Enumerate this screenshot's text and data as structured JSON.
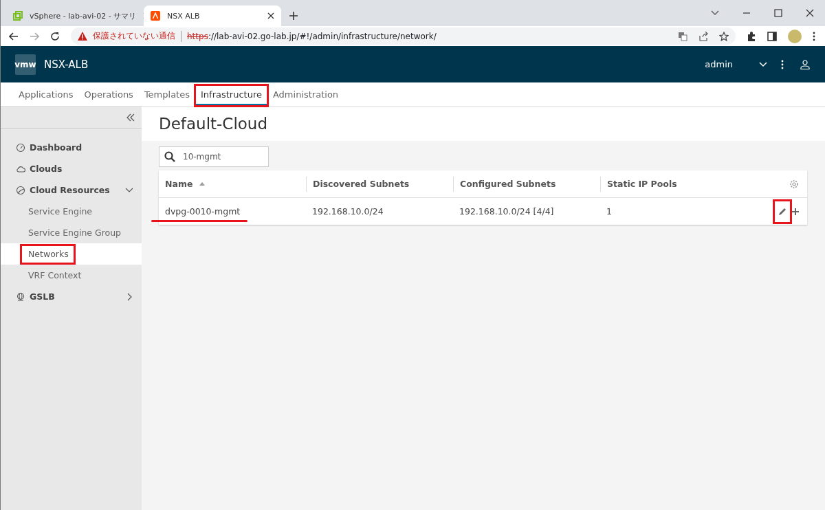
{
  "browser": {
    "tabs": [
      {
        "title": "vSphere - lab-avi-02 - サマリ",
        "kind": "vsphere",
        "selected": false
      },
      {
        "title": "NSX ALB",
        "kind": "avi",
        "selected": true
      }
    ],
    "address": {
      "warning": "保護されていない通信",
      "scheme": "https",
      "rest": "://lab-avi-02.go-lab.jp/#!/admin/infrastructure/network/"
    }
  },
  "app": {
    "logo": "vmw",
    "name": "NSX-ALB",
    "user": "admin"
  },
  "nav": [
    {
      "label": "Applications",
      "selected": false,
      "annotated": false
    },
    {
      "label": "Operations",
      "selected": false,
      "annotated": false
    },
    {
      "label": "Templates",
      "selected": false,
      "annotated": false
    },
    {
      "label": "Infrastructure",
      "selected": true,
      "annotated": true
    },
    {
      "label": "Administration",
      "selected": false,
      "annotated": false
    }
  ],
  "sidebar": {
    "items": [
      {
        "label": "Dashboard",
        "kind": "gauge"
      },
      {
        "label": "Clouds",
        "kind": "cloud"
      },
      {
        "label": "Cloud Resources",
        "kind": "pie",
        "expanded": true,
        "children": [
          {
            "label": "Service Engine",
            "selected": false,
            "annotated": false
          },
          {
            "label": "Service Engine Group",
            "selected": false,
            "annotated": false
          },
          {
            "label": "Networks",
            "selected": true,
            "annotated": true
          },
          {
            "label": "VRF Context",
            "selected": false,
            "annotated": false
          }
        ]
      },
      {
        "label": "GSLB",
        "kind": "globe",
        "expanded": false
      }
    ]
  },
  "page": {
    "title": "Default-Cloud",
    "search": {
      "value": "10-mgmt"
    }
  },
  "table": {
    "columns": [
      {
        "label": "Name",
        "sorted": true
      },
      {
        "label": "Discovered Subnets",
        "sorted": false
      },
      {
        "label": "Configured Subnets",
        "sorted": false
      },
      {
        "label": "Static IP Pools",
        "sorted": false
      }
    ],
    "rows": [
      {
        "cells": [
          "dvpg-0010-mgmt",
          "192.168.10.0/24",
          "192.168.10.0/24 [4/4]",
          "1"
        ],
        "name_underlined": true,
        "edit_annotated": true
      }
    ]
  }
}
